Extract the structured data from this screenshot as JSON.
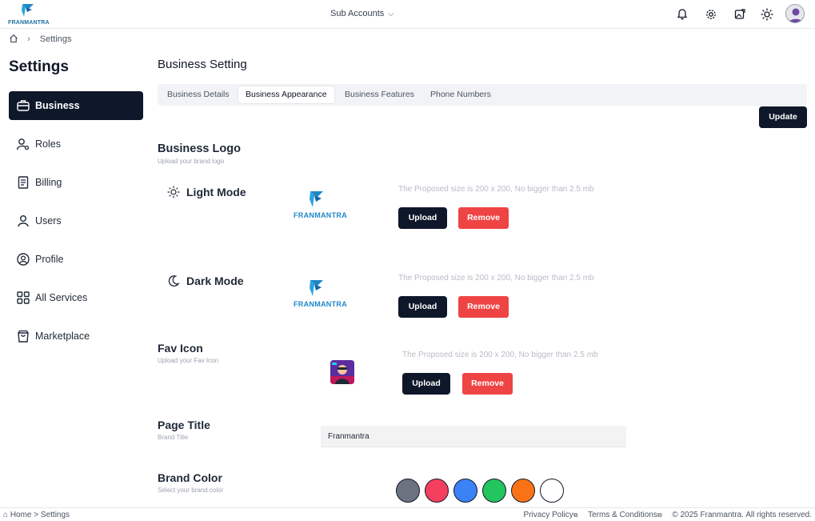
{
  "header": {
    "logo_text": "FRANMANTRA",
    "subaccounts_label": "Sub Accounts",
    "icons": [
      "bell-icon",
      "gear-icon",
      "image-edit-icon",
      "sun-icon",
      "avatar"
    ]
  },
  "breadcrumb": {
    "current": "Settings"
  },
  "sidebar": {
    "title": "Settings",
    "items": [
      {
        "label": "Business",
        "icon": "briefcase-icon",
        "active": true
      },
      {
        "label": "Roles",
        "icon": "user-gear-icon"
      },
      {
        "label": "Billing",
        "icon": "receipt-icon"
      },
      {
        "label": "Users",
        "icon": "user-icon"
      },
      {
        "label": "Profile",
        "icon": "user-circle-icon"
      },
      {
        "label": "All Services",
        "icon": "grid-icon"
      },
      {
        "label": "Marketplace",
        "icon": "shopping-bag-icon"
      }
    ]
  },
  "main": {
    "title": "Business Setting",
    "tabs": [
      "Business Details",
      "Business Appearance",
      "Business Features",
      "Phone Numbers"
    ],
    "active_tab": "Business Appearance",
    "update_label": "Update",
    "logo_section": {
      "title": "Business Logo",
      "subtitle": "Upload your brand logo",
      "light_label": "Light Mode",
      "dark_label": "Dark Mode",
      "hint": "The Proposed size is 200 x 200, No bigger than 2.5 mb",
      "upload_label": "Upload",
      "remove_label": "Remove",
      "logo_text": "FRANMANTRA"
    },
    "fav_section": {
      "title": "Fav Icon",
      "subtitle": "Upload your Fav Icon",
      "hint": "The Proposed size is 200 x 200, No bigger than 2.5 mb",
      "upload_label": "Upload",
      "remove_label": "Remove"
    },
    "page_title_section": {
      "title": "Page Title",
      "subtitle": "Brand Title",
      "value": "Franmantra"
    },
    "brand_color_section": {
      "title": "Brand Color",
      "subtitle": "Select your brand color",
      "colors": [
        "#6b7280",
        "#f43f5e",
        "#3b82f6",
        "#22c55e",
        "#f97316",
        "#ffffff"
      ]
    }
  },
  "footer": {
    "home": "⌂ Home",
    "current": "Settings",
    "privacy": "Privacy Policy",
    "terms": "Terms & Conditions",
    "copyright": "© 2025 Franmantra. All rights reserved."
  }
}
